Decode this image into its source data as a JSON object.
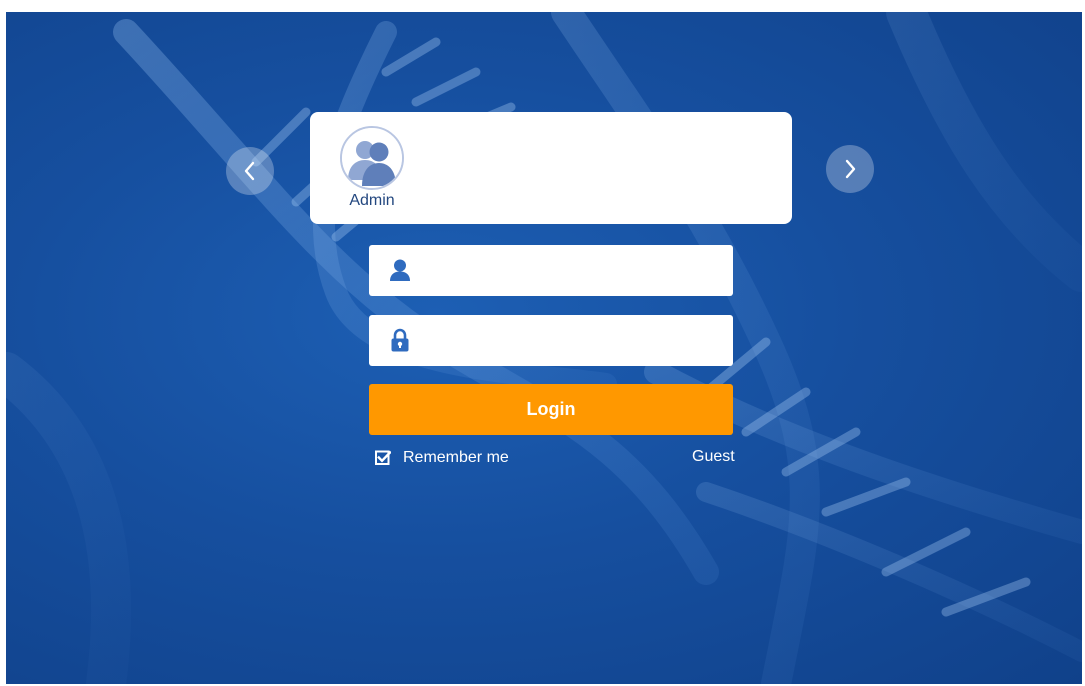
{
  "navigation": {
    "prev_icon": "chevron-left-icon",
    "next_icon": "chevron-right-icon"
  },
  "user_card": {
    "users": [
      {
        "name": "Admin",
        "icon": "users-avatar-icon",
        "selected": true
      }
    ]
  },
  "login_form": {
    "username": {
      "value": "",
      "placeholder": "",
      "icon": "user-icon"
    },
    "password": {
      "value": "",
      "placeholder": "",
      "icon": "lock-icon"
    },
    "login_label": "Login",
    "remember_label": "Remember me",
    "remember_checked": true,
    "guest_label": "Guest"
  },
  "colors": {
    "background": "#164f9f",
    "accent": "#ff9800",
    "icon_blue": "#2f6bbf",
    "text_dark": "#23477f"
  }
}
